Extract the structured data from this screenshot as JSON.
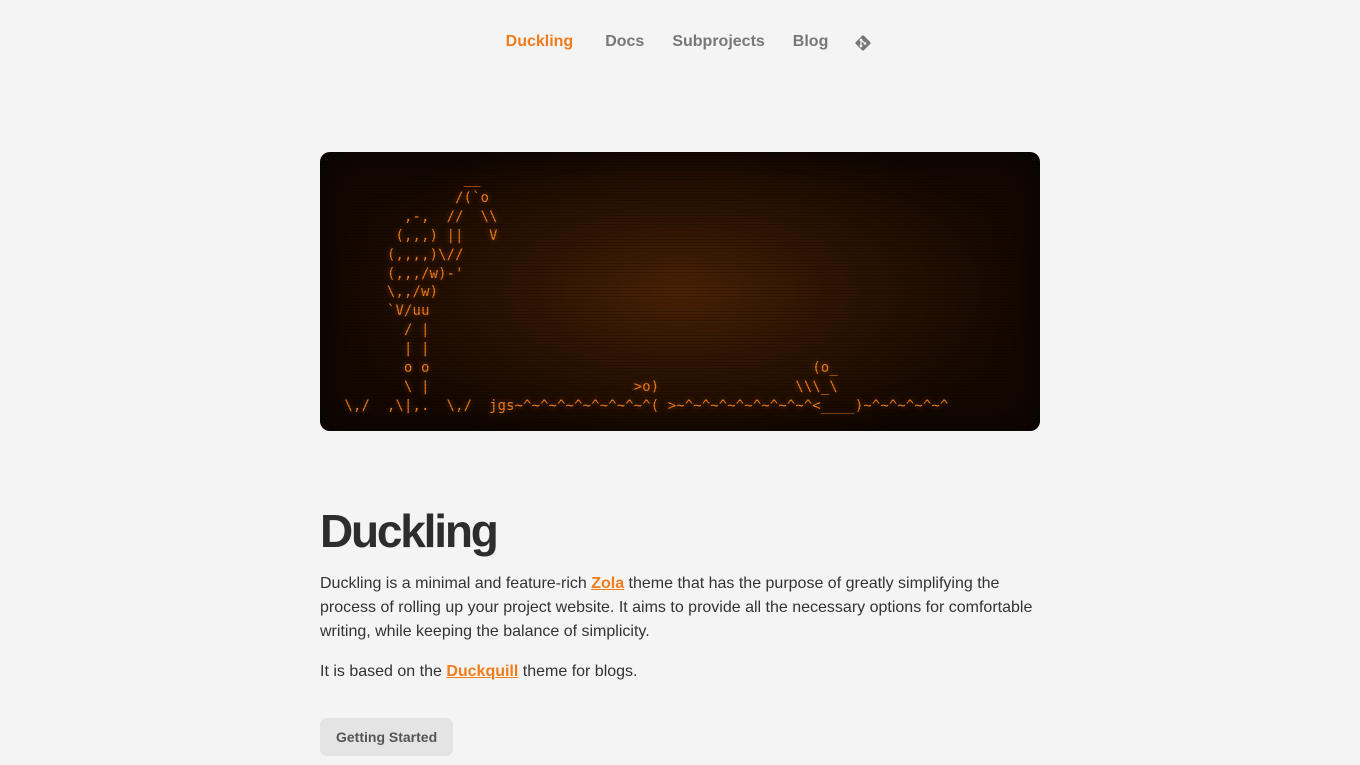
{
  "nav": {
    "brand": "Duckling",
    "items": [
      {
        "label": "Docs"
      },
      {
        "label": "Subprojects"
      },
      {
        "label": "Blog"
      }
    ],
    "repo_icon": "git-icon"
  },
  "hero": {
    "ascii_art": "               __\n              /(`o\n        ,-,  //  \\\\\n       (,,,) ||   V\n      (,,,,)\\//\n      (,,,/w)-'\n      \\,,/w)\n      `V/uu\n        / |\n        | |\n        o o                                             (o_\n        \\ |                        >o)                \\\\\\_\\\n \\,/  ,\\|,.  \\,/  jgs~^~^~^~^~^~^~^~^( >~^~^~^~^~^~^~^~^<____)~^~^~^~^~^"
  },
  "main": {
    "title": "Duckling",
    "intro_before": "Duckling is a minimal and feature-rich ",
    "intro_link": "Zola",
    "intro_after": " theme that has the purpose of greatly simplifying the process of rolling up your project website. It aims to provide all the necessary options for comfortable writing, while keeping the balance of simplicity.",
    "based_before": "It is based on the ",
    "based_link": "Duckquill",
    "based_after": " theme for blogs.",
    "cta_label": "Getting Started"
  },
  "colors": {
    "accent": "#f07c1b",
    "background": "#f4f4f4",
    "text": "#2d2d2d",
    "button_bg": "#e4e4e4"
  }
}
